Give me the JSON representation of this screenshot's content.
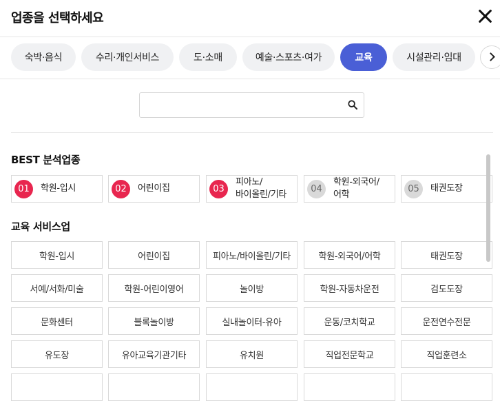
{
  "header": {
    "title": "업종을 선택하세요"
  },
  "tabs": [
    "숙박·음식",
    "수리·개인서비스",
    "도·소매",
    "예술·스포츠·여가",
    "교육",
    "시설관리·임대"
  ],
  "active_tab": "교육",
  "search": {
    "value": "",
    "placeholder": ""
  },
  "best": {
    "title": "BEST 분석업종",
    "items": [
      {
        "num": "01",
        "label": "학원-입시"
      },
      {
        "num": "02",
        "label": "어린이집"
      },
      {
        "num": "03",
        "label": "피아노/\n바이올린/기타"
      },
      {
        "num": "04",
        "label": "학원-외국어/\n어학"
      },
      {
        "num": "05",
        "label": "태권도장"
      }
    ]
  },
  "services": {
    "title": "교육 서비스업",
    "items": [
      "학원-입시",
      "어린이집",
      "피아노/바이올린/기타",
      "학원-외국어/어학",
      "태권도장",
      "서예/서화/미술",
      "학원-어린이영어",
      "놀이방",
      "학원-자동차운전",
      "검도도장",
      "문화센터",
      "블록놀이방",
      "실내놀이터-유아",
      "운동/코치학교",
      "운전연수전문",
      "유도장",
      "유아교육기관기타",
      "유치원",
      "직업전문학교",
      "직업훈련소"
    ]
  },
  "colors": {
    "accent": "#4a5fd6",
    "hot": "#e8264f",
    "cold": "#d9d9d9"
  }
}
